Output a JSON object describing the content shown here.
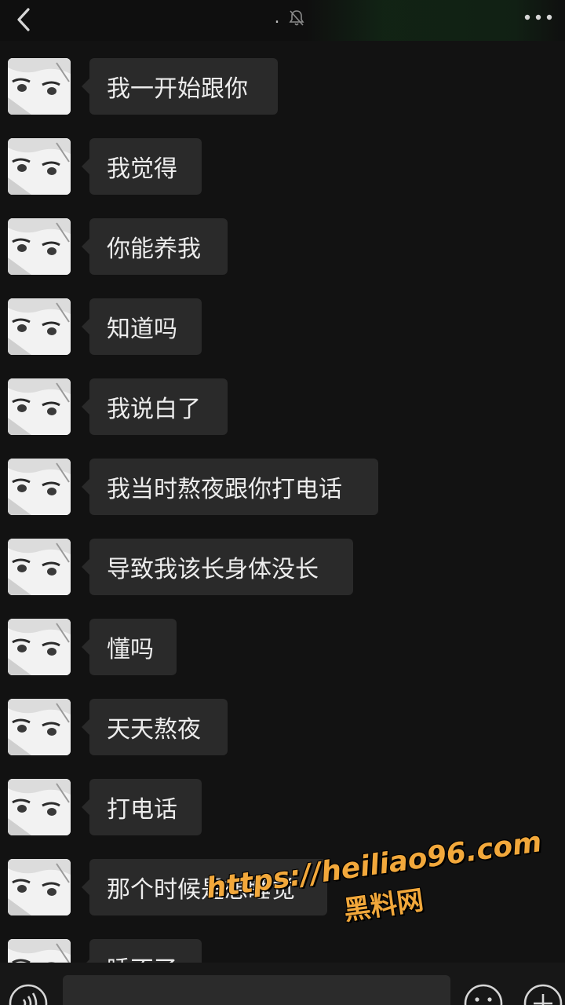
{
  "header": {
    "title": ".",
    "back_icon": "chevron-left-icon",
    "mute_icon": "bell-off-icon",
    "more_icon": "more-dots-icon"
  },
  "messages": [
    {
      "sender": "other",
      "text": "我一开始跟你"
    },
    {
      "sender": "other",
      "text": "我觉得"
    },
    {
      "sender": "other",
      "text": "你能养我"
    },
    {
      "sender": "other",
      "text": "知道吗"
    },
    {
      "sender": "other",
      "text": "我说白了"
    },
    {
      "sender": "other",
      "text": "我当时熬夜跟你打电话"
    },
    {
      "sender": "other",
      "text": "导致我该长身体没长"
    },
    {
      "sender": "other",
      "text": "懂吗"
    },
    {
      "sender": "other",
      "text": "天天熬夜"
    },
    {
      "sender": "other",
      "text": "打电话"
    },
    {
      "sender": "other",
      "text": "那个时候是想睡觉"
    },
    {
      "sender": "other",
      "text": "睡不了"
    }
  ],
  "input_bar": {
    "voice_icon": "voice-icon",
    "input_value": "",
    "emoji_icon": "emoji-icon",
    "plus_icon": "plus-icon"
  },
  "watermark": {
    "url": "https://heiliao96.com",
    "name": "黑料网"
  },
  "colors": {
    "background": "#121212",
    "bubble": "#2a2a2a",
    "text": "#ececec",
    "watermark": "#f2a83b"
  }
}
